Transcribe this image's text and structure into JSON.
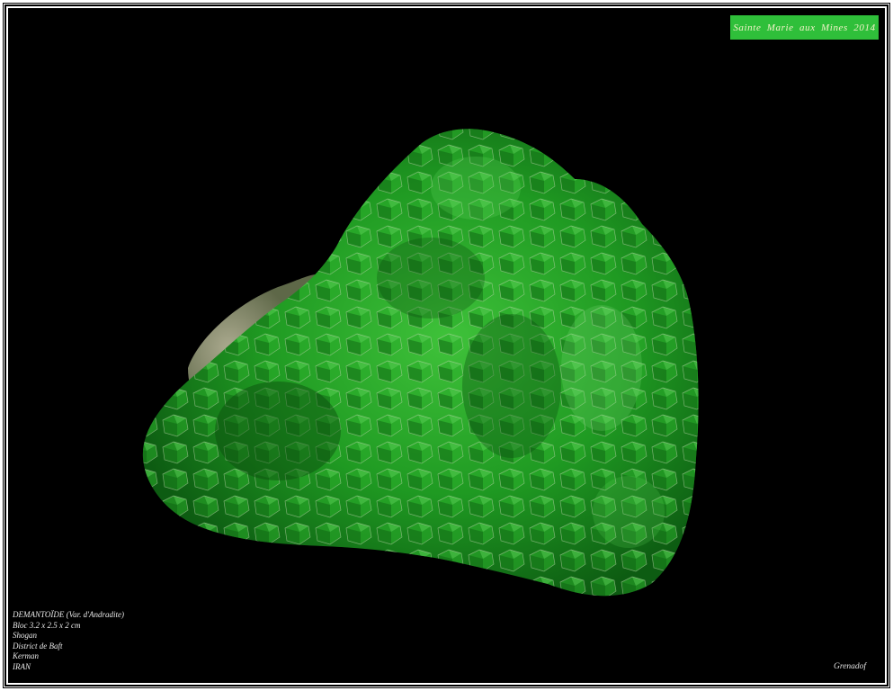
{
  "event_badge": "Sainte  Marie  aux  Mines  2014",
  "caption": {
    "lines": [
      "DEMANTOÏDE (Var. d'Andradite)",
      "Bloc 3.2 x 2.5 x 2 cm",
      "Shogan",
      "District de Baft",
      "Kerman",
      "IRAN"
    ]
  },
  "credit": "Grenadof",
  "colors": {
    "background": "#000000",
    "specimen_green": "#1f9a22",
    "matrix": "#9aa08a",
    "badge": "#2fbf3a"
  }
}
